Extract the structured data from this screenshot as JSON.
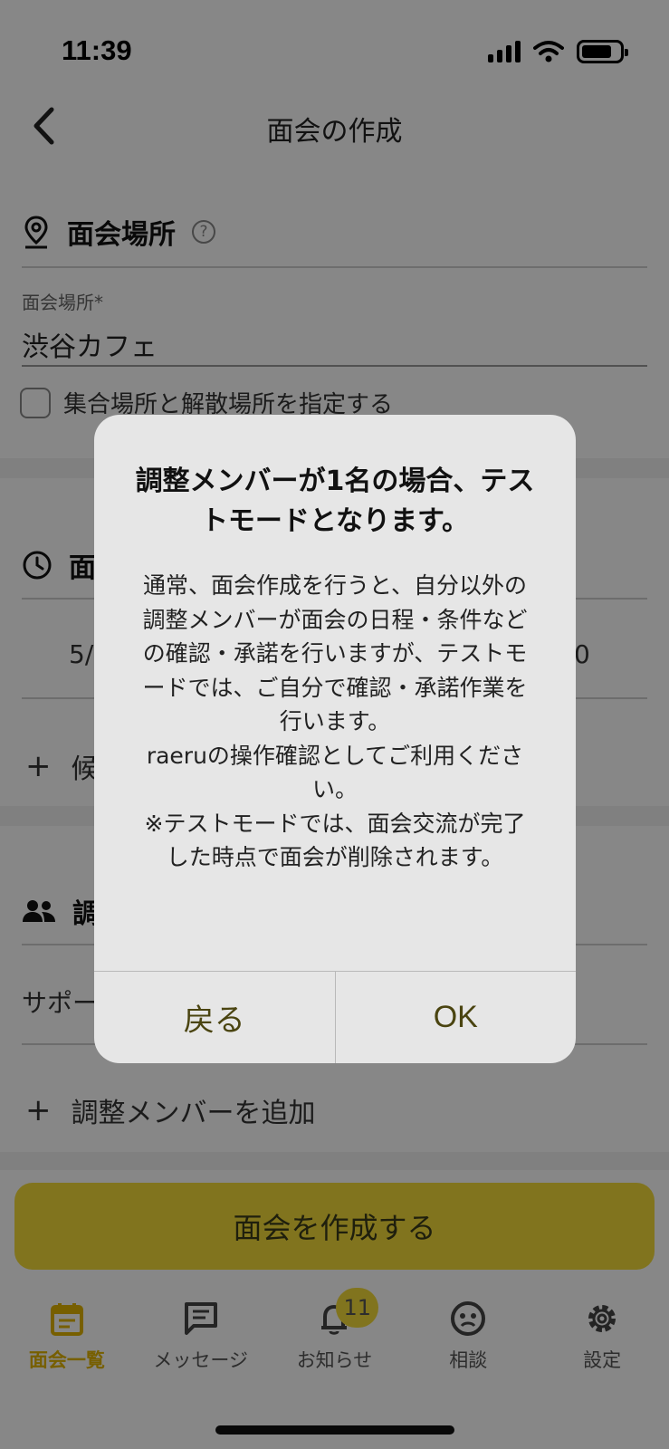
{
  "status_bar": {
    "time": "11:39"
  },
  "nav": {
    "title": "面会の作成"
  },
  "location_section": {
    "title": "面会場所",
    "help_glyph": "?",
    "field_label": "面会場所*",
    "field_value": "渋谷カフェ",
    "checkbox_label": "集合場所と解散場所を指定する"
  },
  "schedule_section": {
    "title_partial": "面",
    "date_partial": "5/",
    "time_partial": "0",
    "add_partial": "候"
  },
  "members_section": {
    "title_partial": "調",
    "member_partial": "サポー",
    "add_member": "調整メンバーを追加"
  },
  "create_button": "面会を作成する",
  "tabbar": {
    "tabs": [
      {
        "label": "面会一覧",
        "icon": "calendar-icon",
        "active": true
      },
      {
        "label": "メッセージ",
        "icon": "message-icon"
      },
      {
        "label": "お知らせ",
        "icon": "bell-icon",
        "badge": "11"
      },
      {
        "label": "相談",
        "icon": "consult-icon"
      },
      {
        "label": "設定",
        "icon": "gear-icon"
      }
    ]
  },
  "dialog": {
    "title": "調整メンバーが1名の場合、テストモードとなります。",
    "body": "通常、面会作成を行うと、自分以外の調整メンバーが面会の日程・条件などの確認・承諾を行いますが、テストモードでは、ご自分で確認・承諾作業を行います。\nraeruの操作確認としてご利用ください。\n※テストモードでは、面会交流が完了した時点で面会が削除されます。",
    "cancel": "戻る",
    "ok": "OK"
  },
  "colors": {
    "accent": "#f4dc3a",
    "tab_active": "#e0b400",
    "overlay": "rgba(0,0,0,0.47)"
  }
}
